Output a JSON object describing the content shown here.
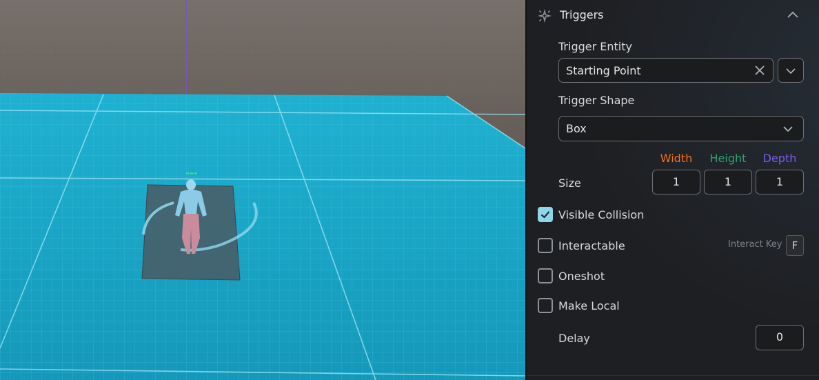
{
  "panel": {
    "title": "Triggers",
    "section_icon": "sparkle-icon",
    "trigger_entity": {
      "label": "Trigger Entity",
      "value": "Starting Point"
    },
    "trigger_shape": {
      "label": "Trigger Shape",
      "value": "Box"
    },
    "size": {
      "label": "Size",
      "width_label": "Width",
      "height_label": "Height",
      "depth_label": "Depth",
      "width": "1",
      "height": "1",
      "depth": "1"
    },
    "visible_collision": {
      "label": "Visible Collision",
      "checked": true
    },
    "interactable": {
      "label": "Interactable",
      "checked": false,
      "key_label": "Interact Key",
      "key": "F"
    },
    "oneshot": {
      "label": "Oneshot",
      "checked": false
    },
    "make_local": {
      "label": "Make Local",
      "checked": false
    },
    "delay": {
      "label": "Delay",
      "value": "0"
    }
  },
  "colors": {
    "width_axis": "#f0731e",
    "height_axis": "#2ca36f",
    "depth_axis": "#7b5cf0",
    "checkbox_accent": "#8ed6ea",
    "ground": "#1aa7c9"
  }
}
